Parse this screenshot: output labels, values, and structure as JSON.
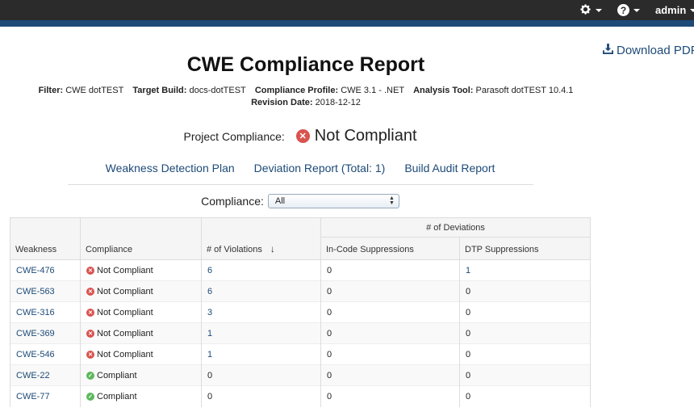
{
  "topbar": {
    "user": "admin"
  },
  "download_label": "Download PDF",
  "title": "CWE Compliance Report",
  "meta": {
    "filter_label": "Filter:",
    "filter": "CWE dotTEST",
    "build_label": "Target Build:",
    "build": "docs-dotTEST",
    "profile_label": "Compliance Profile:",
    "profile": "CWE 3.1 - .NET",
    "tool_label": "Analysis Tool:",
    "tool": "Parasoft dotTEST 10.4.1",
    "revision_label": "Revision Date:",
    "revision": "2018-12-12"
  },
  "project": {
    "label": "Project Compliance:",
    "status": "Not Compliant"
  },
  "links": {
    "plan": "Weakness Detection Plan",
    "deviation": "Deviation Report (Total: 1)",
    "audit": "Build Audit Report"
  },
  "compliance_filter": {
    "label": "Compliance:",
    "value": "All"
  },
  "table": {
    "headers": {
      "weakness": "Weakness",
      "compliance": "Compliance",
      "violations": "# of Violations",
      "deviations": "# of Deviations",
      "in_code": "In-Code Suppressions",
      "dtp": "DTP Suppressions"
    },
    "rows": [
      {
        "weakness": "CWE-476",
        "status": "Not Compliant",
        "ok": false,
        "violations": "6",
        "in_code": "0",
        "dtp": "1"
      },
      {
        "weakness": "CWE-563",
        "status": "Not Compliant",
        "ok": false,
        "violations": "6",
        "in_code": "0",
        "dtp": "0"
      },
      {
        "weakness": "CWE-316",
        "status": "Not Compliant",
        "ok": false,
        "violations": "3",
        "in_code": "0",
        "dtp": "0"
      },
      {
        "weakness": "CWE-369",
        "status": "Not Compliant",
        "ok": false,
        "violations": "1",
        "in_code": "0",
        "dtp": "0"
      },
      {
        "weakness": "CWE-546",
        "status": "Not Compliant",
        "ok": false,
        "violations": "1",
        "in_code": "0",
        "dtp": "0"
      },
      {
        "weakness": "CWE-22",
        "status": "Compliant",
        "ok": true,
        "violations": "0",
        "in_code": "0",
        "dtp": "0"
      },
      {
        "weakness": "CWE-77",
        "status": "Compliant",
        "ok": true,
        "violations": "0",
        "in_code": "0",
        "dtp": "0"
      }
    ]
  },
  "colors": {
    "link": "#1d4a78",
    "bad": "#d9534f",
    "good": "#5cb85c",
    "topbar": "#2b2b2b",
    "accent": "#1d4a78"
  }
}
